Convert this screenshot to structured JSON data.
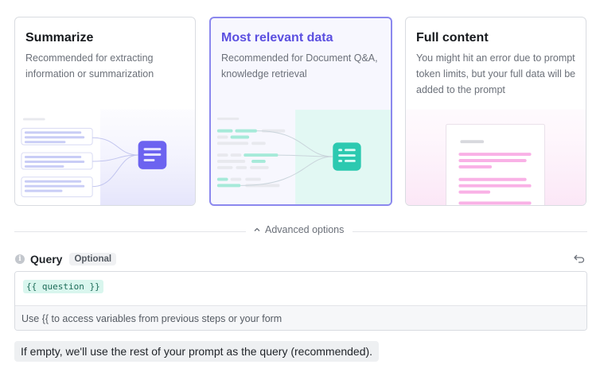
{
  "cards": [
    {
      "title": "Summarize",
      "description": "Recommended for extracting information or summarization",
      "selected": false
    },
    {
      "title": "Most relevant data",
      "description": "Recommended for Document Q&A, knowledge retrieval",
      "selected": true
    },
    {
      "title": "Full content",
      "description": "You might hit an error due to prompt token limits, but your full data will be added to the prompt",
      "selected": false
    }
  ],
  "advanced": {
    "label": "Advanced options",
    "icon": "chevron-up-icon"
  },
  "query": {
    "label": "Query",
    "badge": "Optional",
    "value": "{{ question }}",
    "help": "Use {{ to access variables from previous steps or your form"
  },
  "note": "If empty, we'll use the rest of your prompt as the query (recommended).",
  "colors": {
    "accent": "#5b4fe0",
    "summarize": "#6c63f0",
    "relevant": "#2cc9b0",
    "full": "#f5a3e0"
  }
}
